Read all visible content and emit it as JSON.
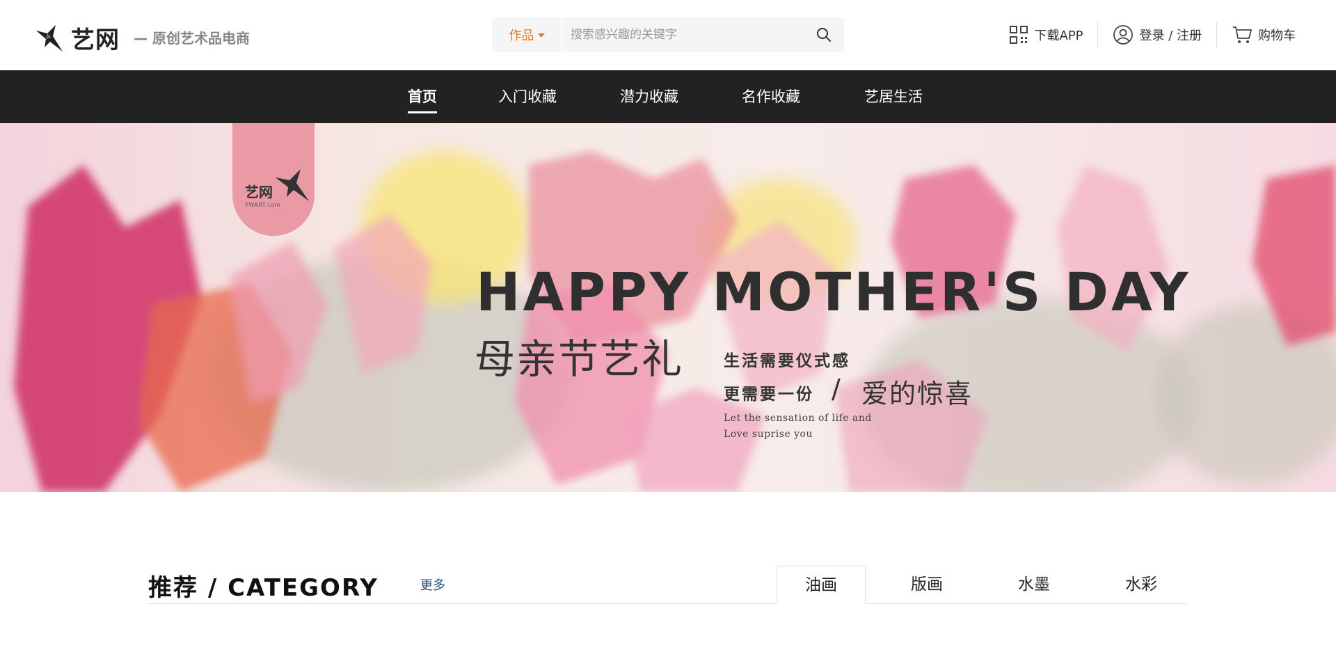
{
  "header": {
    "logo_text": "艺网",
    "slogan": "— 原创艺术品电商",
    "search": {
      "category": "作品",
      "placeholder": "搜索感兴趣的关键字"
    },
    "links": {
      "download_app": "下载APP",
      "login_register": "登录 / 注册",
      "cart": "购物车"
    }
  },
  "nav": {
    "items": [
      {
        "label": "首页",
        "active": true
      },
      {
        "label": "入门收藏"
      },
      {
        "label": "潜力收藏"
      },
      {
        "label": "名作收藏"
      },
      {
        "label": "艺居生活"
      }
    ]
  },
  "banner": {
    "tag_logo": "艺网",
    "tag_sub": "YWART.com",
    "headline": "HAPPY MOTHER'S DAY",
    "title": "母亲节艺礼",
    "line1": "生活需要仪式感",
    "line2_prefix": "更需要一份",
    "line2_slash": "/",
    "line2_emphasis": "爱的惊喜",
    "en_line1": "Let the sensation of life and",
    "en_line2": "Love suprise you"
  },
  "category": {
    "title": "推荐 / CATEGORY",
    "more": "更多",
    "tabs": [
      {
        "label": "油画",
        "active": true
      },
      {
        "label": "版画"
      },
      {
        "label": "水墨"
      },
      {
        "label": "水彩"
      }
    ]
  },
  "colors": {
    "accent": "#e07b2e",
    "nav_bg": "#222222",
    "more_link": "#2a4f7a"
  }
}
